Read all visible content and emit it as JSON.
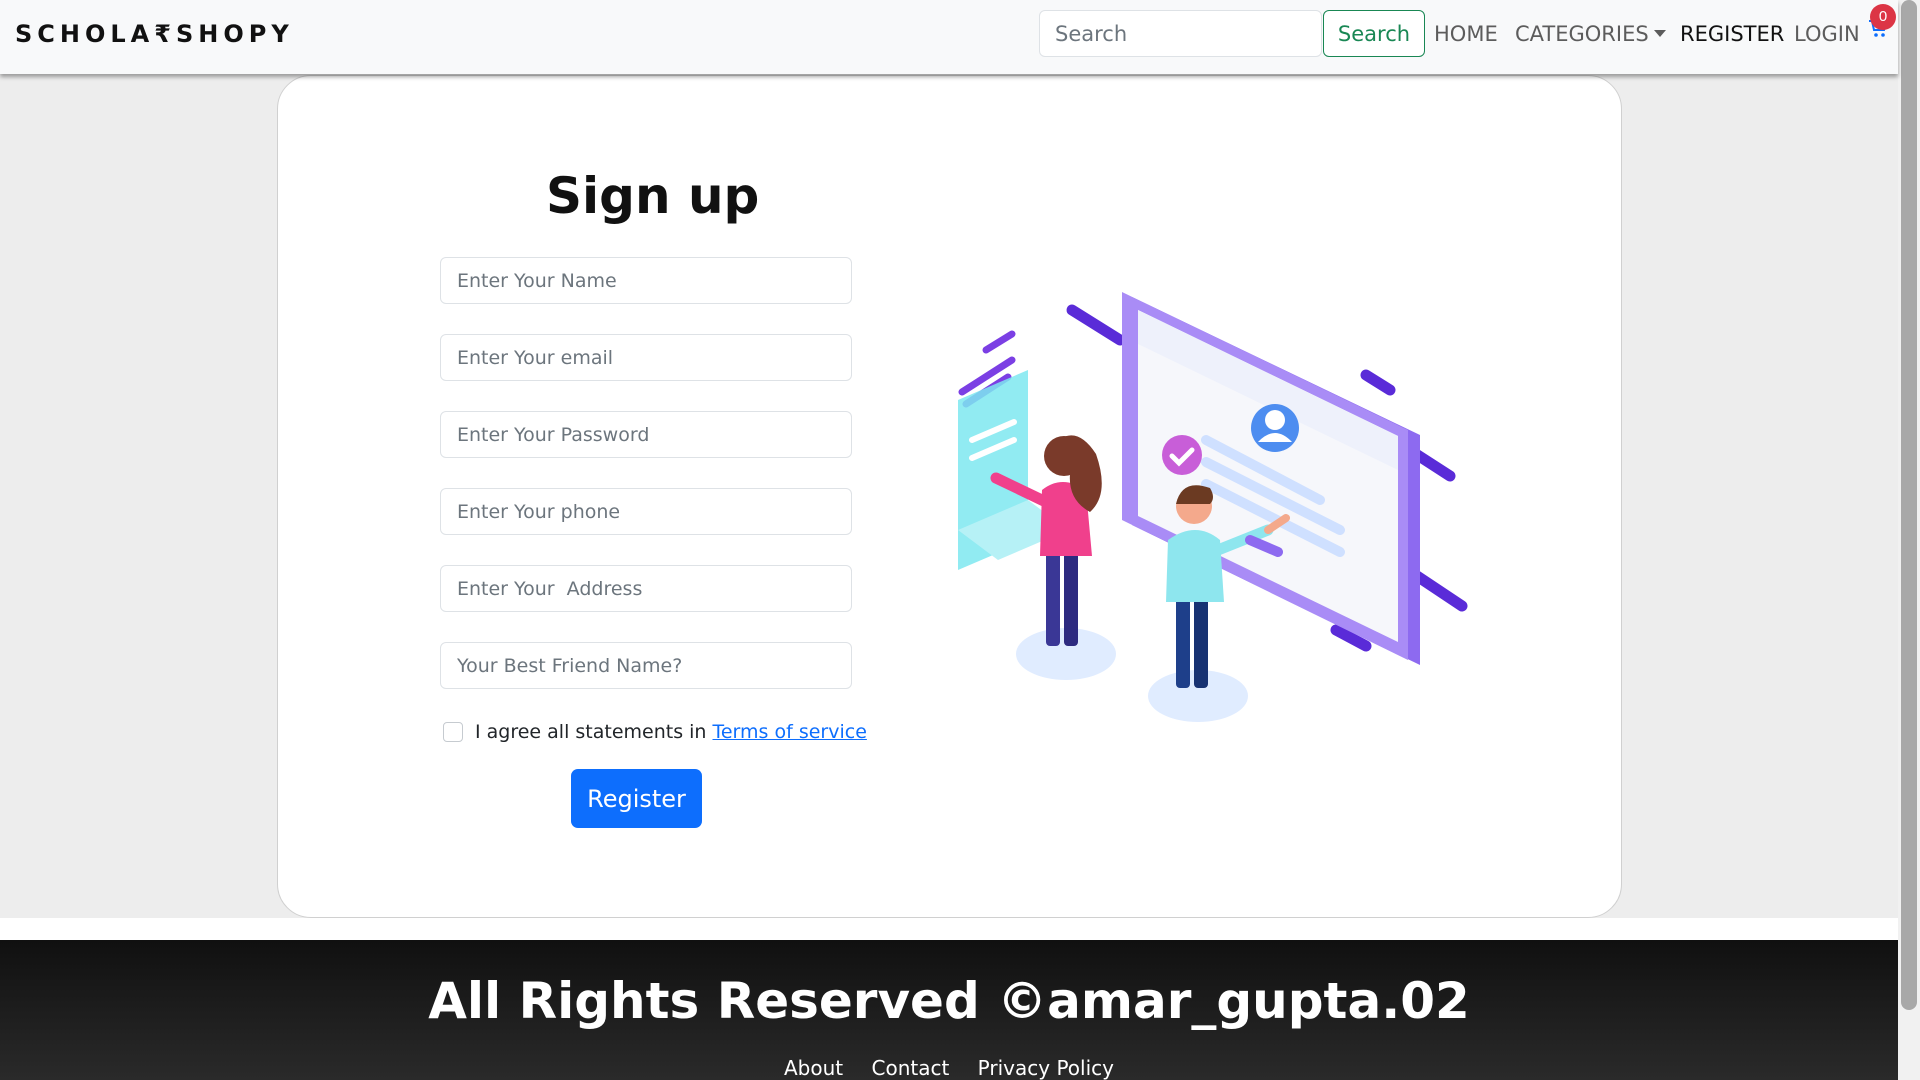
{
  "navbar": {
    "brand": "SCHOLA₹SHOPY",
    "search": {
      "placeholder": "Search",
      "button_label": "Search"
    },
    "links": {
      "home": "HOME",
      "categories": "CATEGORIES",
      "register": "REGISTER",
      "login": "LOGIN"
    },
    "cart": {
      "icon": "cart-icon",
      "count": "0"
    }
  },
  "form": {
    "title": "Sign up",
    "fields": {
      "name": "Enter Your Name",
      "email": "Enter Your email",
      "password": "Enter Your Password",
      "phone": "Enter Your phone",
      "address": "Enter Your  Address",
      "answer": "Your Best Friend Name?"
    },
    "terms_text": "I agree all statements in",
    "terms_link": "Terms of service",
    "register_label": "Register"
  },
  "footer": {
    "copyright": "All Rights Reserved ©amar_gupta.02",
    "links": {
      "about": "About",
      "contact": "Contact",
      "privacy": "Privacy Policy"
    }
  },
  "colors": {
    "primary": "#0d6efd",
    "success": "#198754",
    "badge": "#dc3545",
    "illustration_purple": "#7b3fe4"
  }
}
